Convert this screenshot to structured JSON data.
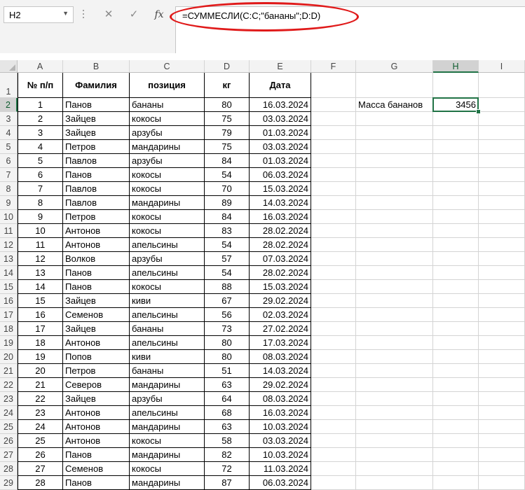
{
  "formula_bar": {
    "name_box": "H2",
    "cancel_icon": "✕",
    "enter_icon": "✓",
    "fx_label": "fx",
    "formula": "=СУММЕСЛИ(C:C;\"бананы\";D:D)"
  },
  "columns": [
    "A",
    "B",
    "C",
    "D",
    "E",
    "F",
    "G",
    "H",
    "I"
  ],
  "headers": {
    "num": "№ п/п",
    "surname": "Фамилия",
    "position": "позиция",
    "kg": "кг",
    "date": "Дата"
  },
  "summary": {
    "label": "Масса бананов",
    "value": "3456"
  },
  "rows": [
    {
      "n": "1",
      "name": "Панов",
      "item": "бананы",
      "kg": "80",
      "date": "16.03.2024"
    },
    {
      "n": "2",
      "name": "Зайцев",
      "item": "кокосы",
      "kg": "75",
      "date": "03.03.2024"
    },
    {
      "n": "3",
      "name": "Зайцев",
      "item": "арзубы",
      "kg": "79",
      "date": "01.03.2024"
    },
    {
      "n": "4",
      "name": "Петров",
      "item": "мандарины",
      "kg": "75",
      "date": "03.03.2024"
    },
    {
      "n": "5",
      "name": "Павлов",
      "item": "арзубы",
      "kg": "84",
      "date": "01.03.2024"
    },
    {
      "n": "6",
      "name": "Панов",
      "item": "кокосы",
      "kg": "54",
      "date": "06.03.2024"
    },
    {
      "n": "7",
      "name": "Павлов",
      "item": "кокосы",
      "kg": "70",
      "date": "15.03.2024"
    },
    {
      "n": "8",
      "name": "Павлов",
      "item": "мандарины",
      "kg": "89",
      "date": "14.03.2024"
    },
    {
      "n": "9",
      "name": "Петров",
      "item": "кокосы",
      "kg": "84",
      "date": "16.03.2024"
    },
    {
      "n": "10",
      "name": "Антонов",
      "item": "кокосы",
      "kg": "83",
      "date": "28.02.2024"
    },
    {
      "n": "11",
      "name": "Антонов",
      "item": "апельсины",
      "kg": "54",
      "date": "28.02.2024"
    },
    {
      "n": "12",
      "name": "Волков",
      "item": "арзубы",
      "kg": "57",
      "date": "07.03.2024"
    },
    {
      "n": "13",
      "name": "Панов",
      "item": "апельсины",
      "kg": "54",
      "date": "28.02.2024"
    },
    {
      "n": "14",
      "name": "Панов",
      "item": "кокосы",
      "kg": "88",
      "date": "15.03.2024"
    },
    {
      "n": "15",
      "name": "Зайцев",
      "item": "киви",
      "kg": "67",
      "date": "29.02.2024"
    },
    {
      "n": "16",
      "name": "Семенов",
      "item": "апельсины",
      "kg": "56",
      "date": "02.03.2024"
    },
    {
      "n": "17",
      "name": "Зайцев",
      "item": "бананы",
      "kg": "73",
      "date": "27.02.2024"
    },
    {
      "n": "18",
      "name": "Антонов",
      "item": "апельсины",
      "kg": "80",
      "date": "17.03.2024"
    },
    {
      "n": "19",
      "name": "Попов",
      "item": "киви",
      "kg": "80",
      "date": "08.03.2024"
    },
    {
      "n": "20",
      "name": "Петров",
      "item": "бананы",
      "kg": "51",
      "date": "14.03.2024"
    },
    {
      "n": "21",
      "name": "Северов",
      "item": "мандарины",
      "kg": "63",
      "date": "29.02.2024"
    },
    {
      "n": "22",
      "name": "Зайцев",
      "item": "арзубы",
      "kg": "64",
      "date": "08.03.2024"
    },
    {
      "n": "23",
      "name": "Антонов",
      "item": "апельсины",
      "kg": "68",
      "date": "16.03.2024"
    },
    {
      "n": "24",
      "name": "Антонов",
      "item": "мандарины",
      "kg": "63",
      "date": "10.03.2024"
    },
    {
      "n": "25",
      "name": "Антонов",
      "item": "кокосы",
      "kg": "58",
      "date": "03.03.2024"
    },
    {
      "n": "26",
      "name": "Панов",
      "item": "мандарины",
      "kg": "82",
      "date": "10.03.2024"
    },
    {
      "n": "27",
      "name": "Семенов",
      "item": "кокосы",
      "kg": "72",
      "date": "11.03.2024"
    },
    {
      "n": "28",
      "name": "Панов",
      "item": "мандарины",
      "kg": "87",
      "date": "06.03.2024"
    }
  ]
}
